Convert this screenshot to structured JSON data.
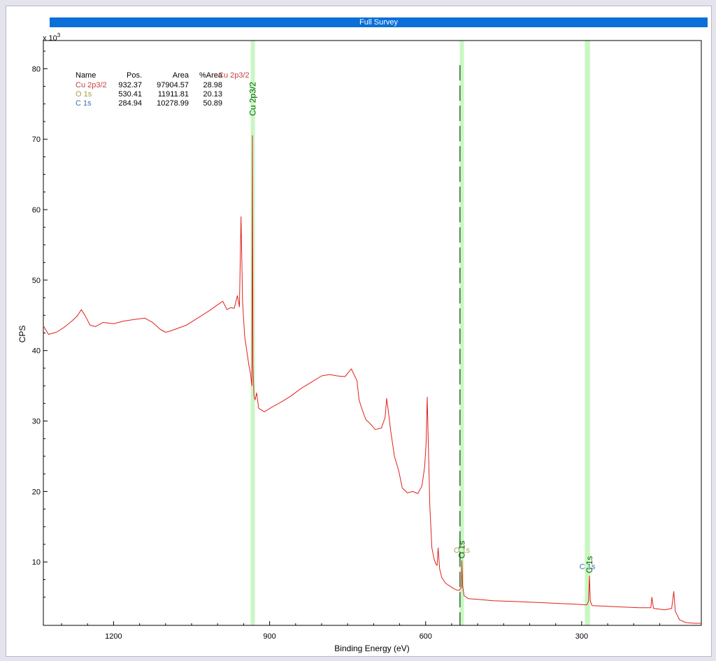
{
  "chart_data": {
    "type": "line",
    "title": "Full Survey",
    "xlabel": "Binding Energy (eV)",
    "ylabel": "CPS",
    "y_multiplier_label": "x 10",
    "y_multiplier_exp": "3",
    "xlim": [
      1335,
      70
    ],
    "ylim": [
      1,
      84
    ],
    "x_ticks": [
      1200,
      900,
      600,
      300
    ],
    "y_ticks": [
      10,
      20,
      30,
      40,
      50,
      60,
      70,
      80
    ],
    "grid": false,
    "colors": {
      "spectrum": "#e0201a",
      "region": "#c9f7c4",
      "peak_label": "#006600",
      "marker": "#004400",
      "title_bar": "#0a6fd8"
    },
    "series": [
      {
        "values": [
          [
            1335,
            43.5
          ],
          [
            1325,
            42.3
          ],
          [
            1310,
            42.6
          ],
          [
            1295,
            43.3
          ],
          [
            1280,
            44.2
          ],
          [
            1270,
            44.9
          ],
          [
            1262,
            45.8
          ],
          [
            1255,
            45.0
          ],
          [
            1245,
            43.6
          ],
          [
            1235,
            43.4
          ],
          [
            1220,
            44.0
          ],
          [
            1200,
            43.8
          ],
          [
            1180,
            44.2
          ],
          [
            1160,
            44.4
          ],
          [
            1140,
            44.6
          ],
          [
            1125,
            44.0
          ],
          [
            1110,
            43.0
          ],
          [
            1100,
            42.6
          ],
          [
            1090,
            42.8
          ],
          [
            1075,
            43.2
          ],
          [
            1060,
            43.6
          ],
          [
            1045,
            44.3
          ],
          [
            1030,
            45.0
          ],
          [
            1015,
            45.7
          ],
          [
            1000,
            46.5
          ],
          [
            990,
            47.0
          ],
          [
            982,
            45.8
          ],
          [
            975,
            46.1
          ],
          [
            968,
            46.0
          ],
          [
            962,
            47.8
          ],
          [
            958,
            46.2
          ],
          [
            955,
            59.0
          ],
          [
            952,
            47.0
          ],
          [
            948,
            42.0
          ],
          [
            944,
            40.0
          ],
          [
            940,
            38.0
          ],
          [
            937,
            36.8
          ],
          [
            934,
            35.0
          ],
          [
            933,
            70.5
          ],
          [
            932,
            38.0
          ],
          [
            930,
            33.5
          ],
          [
            928,
            33.0
          ],
          [
            925,
            34.0
          ],
          [
            921,
            31.8
          ],
          [
            910,
            31.3
          ],
          [
            895,
            32.0
          ],
          [
            880,
            32.6
          ],
          [
            860,
            33.5
          ],
          [
            840,
            34.6
          ],
          [
            820,
            35.5
          ],
          [
            800,
            36.4
          ],
          [
            785,
            36.6
          ],
          [
            770,
            36.4
          ],
          [
            755,
            36.3
          ],
          [
            743,
            37.4
          ],
          [
            737,
            36.5
          ],
          [
            732,
            35.7
          ],
          [
            728,
            33.0
          ],
          [
            722,
            31.6
          ],
          [
            715,
            30.2
          ],
          [
            705,
            29.5
          ],
          [
            697,
            28.8
          ],
          [
            685,
            29.0
          ],
          [
            678,
            30.5
          ],
          [
            675,
            33.2
          ],
          [
            671,
            31.0
          ],
          [
            667,
            28.5
          ],
          [
            660,
            25.0
          ],
          [
            652,
            23.0
          ],
          [
            645,
            20.5
          ],
          [
            635,
            19.8
          ],
          [
            625,
            20.0
          ],
          [
            615,
            19.7
          ],
          [
            607,
            20.8
          ],
          [
            602,
            23.5
          ],
          [
            599,
            27.0
          ],
          [
            597,
            33.4
          ],
          [
            595,
            27.0
          ],
          [
            592,
            18.0
          ],
          [
            588,
            12.0
          ],
          [
            584,
            10.5
          ],
          [
            581,
            9.8
          ],
          [
            578,
            9.5
          ],
          [
            576,
            12.0
          ],
          [
            573,
            9.0
          ],
          [
            569,
            7.8
          ],
          [
            562,
            7.0
          ],
          [
            548,
            6.3
          ],
          [
            540,
            6.0
          ],
          [
            535,
            6.0
          ],
          [
            531,
            6.4
          ],
          [
            530.4,
            10.2
          ],
          [
            529,
            6.6
          ],
          [
            526,
            5.2
          ],
          [
            518,
            4.8
          ],
          [
            500,
            4.7
          ],
          [
            470,
            4.5
          ],
          [
            430,
            4.4
          ],
          [
            400,
            4.3
          ],
          [
            370,
            4.2
          ],
          [
            340,
            4.1
          ],
          [
            310,
            4.0
          ],
          [
            290,
            3.9
          ],
          [
            287,
            4.4
          ],
          [
            285,
            8.0
          ],
          [
            283.5,
            4.5
          ],
          [
            280,
            3.8
          ],
          [
            250,
            3.7
          ],
          [
            220,
            3.6
          ],
          [
            190,
            3.5
          ],
          [
            167,
            3.5
          ],
          [
            165,
            5.0
          ],
          [
            162,
            3.4
          ],
          [
            140,
            3.2
          ],
          [
            127,
            3.4
          ],
          [
            123,
            5.8
          ],
          [
            120,
            3.0
          ],
          [
            112,
            1.8
          ],
          [
            100,
            1.4
          ],
          [
            85,
            1.3
          ],
          [
            70,
            1.3
          ]
        ]
      }
    ],
    "regions": [
      {
        "label": "Cu 2p3/2",
        "x": 932.37,
        "width_eV": 8
      },
      {
        "label": "O 1s",
        "x": 530.41,
        "width_eV": 8
      },
      {
        "label": "C 1s",
        "x": 289,
        "width_eV": 10
      }
    ],
    "marker_line": {
      "x": 534,
      "style": "dashed"
    },
    "annotations": [
      {
        "text": "Cu 2p3/2",
        "x": 932.37,
        "y": 73.0,
        "rotate": true
      },
      {
        "text": "O 1s",
        "x": 530.41,
        "y": 10.2,
        "rotate": true
      },
      {
        "text": "C 1s",
        "x": 285,
        "y": 8.1,
        "rotate": true
      },
      {
        "text": "O 1s",
        "x": 530.41,
        "y": 11.3,
        "rotate": false,
        "color": "#a8a050"
      },
      {
        "text": "C 1s",
        "x": 289,
        "y": 9.0,
        "rotate": false,
        "color": "#3c6fa8"
      }
    ],
    "peak_table": {
      "headers": [
        "Name",
        "Pos.",
        "Area",
        "%Area"
      ],
      "rows": [
        {
          "name": "Cu 2p3/2",
          "pos": "932.37",
          "area": "97904.57",
          "pct": "28.98",
          "color": "#c84040"
        },
        {
          "name": "O 1s",
          "pos": "530.41",
          "area": "11911.81",
          "pct": "20.13",
          "color": "#a8a040"
        },
        {
          "name": "C 1s",
          "pos": "284.94",
          "area": "10278.99",
          "pct": "50.89",
          "color": "#3c6fb0"
        }
      ],
      "overlay_text": "Cu 2p3/2"
    }
  }
}
